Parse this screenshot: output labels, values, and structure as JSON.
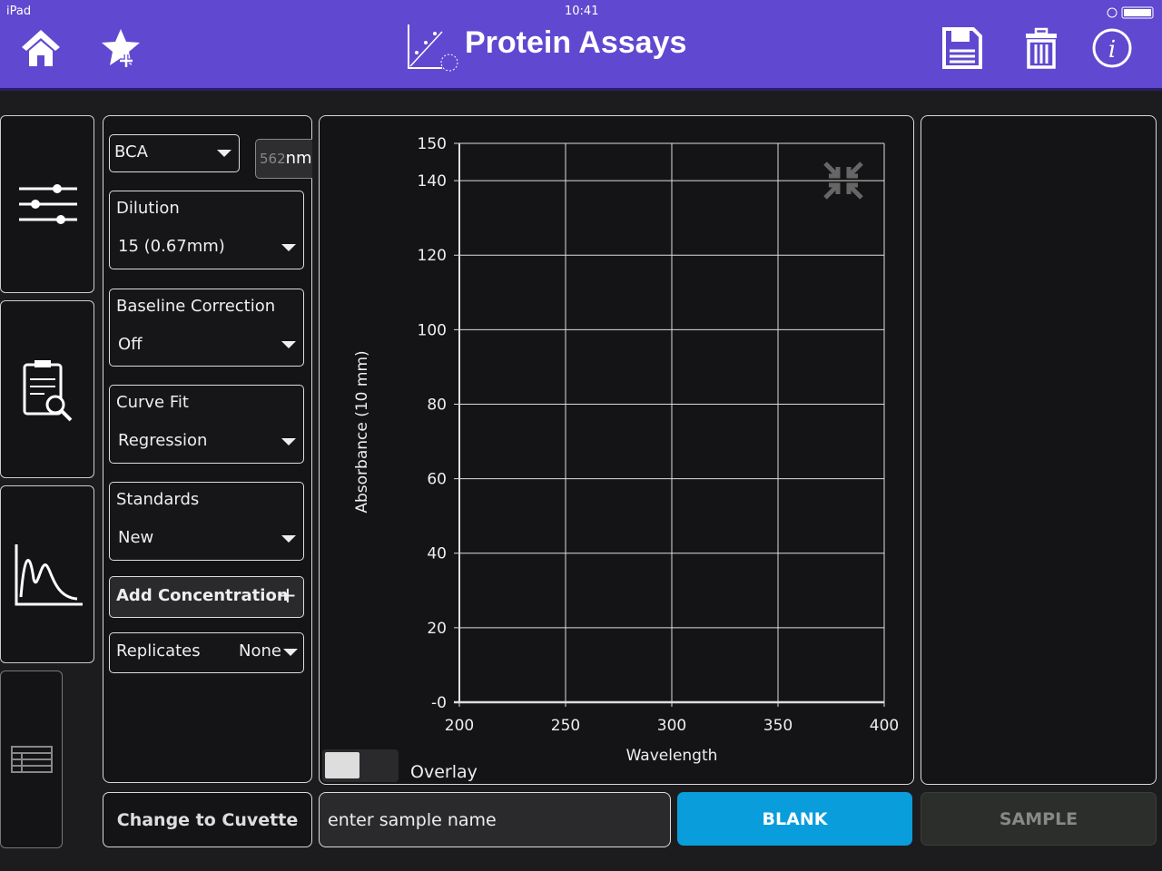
{
  "status": {
    "device": "iPad",
    "time": "10:41"
  },
  "header": {
    "title": "Protein Assays",
    "icons": [
      "home-icon",
      "star-add-icon",
      "save-icon",
      "trash-icon",
      "info-icon"
    ]
  },
  "settings": {
    "assay": "BCA",
    "wavelength_value": "562",
    "wavelength_unit": "nm",
    "dilution": {
      "label": "Dilution",
      "value": "15 (0.67mm)"
    },
    "baseline": {
      "label": "Baseline Correction",
      "value": "Off"
    },
    "curve_fit": {
      "label": "Curve Fit",
      "value": "Regression"
    },
    "standards": {
      "label": "Standards",
      "value": "New"
    },
    "add_concentration": "Add Concentration",
    "replicates": {
      "label": "Replicates",
      "value": "None"
    }
  },
  "overlay_label": "Overlay",
  "bottom": {
    "change_button": "Change to Cuvette",
    "sample_placeholder": "enter sample name",
    "blank_button": "BLANK",
    "sample_button": "SAMPLE"
  },
  "colors": {
    "header": "#6049d0",
    "blank": "#0a9ddc"
  },
  "chart_data": {
    "type": "line",
    "xlabel": "Wavelength",
    "ylabel": "Absorbance (10 mm)",
    "xlim": [
      200,
      400
    ],
    "ylim": [
      0,
      150
    ],
    "xticks": [
      "200",
      "250",
      "300",
      "350",
      "400"
    ],
    "yticks": [
      "-0",
      "20",
      "40",
      "60",
      "80",
      "100",
      "120",
      "140",
      "150"
    ],
    "grid": true,
    "series": []
  }
}
